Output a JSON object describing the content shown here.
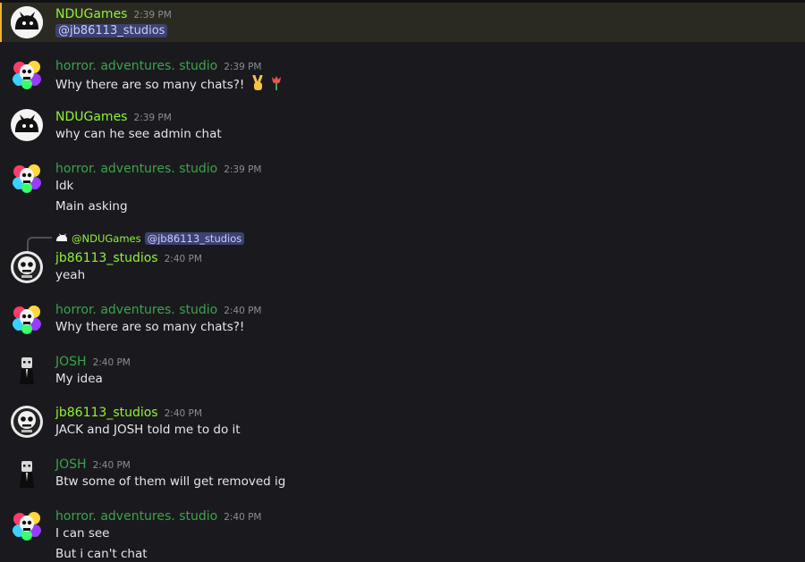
{
  "users": {
    "ndu": "NDUGames",
    "horror": "horror. adventures. studio",
    "jb": "jb86113_studios",
    "josh": "JOSH"
  },
  "colors": {
    "background": "#1a1a1e",
    "highlight": "#2b2a22",
    "green_name": "#8ff238",
    "dark_green_name": "#3ca34a",
    "mention_bg": "#3c4270"
  },
  "messages": [
    {
      "author": "NDUGames",
      "time": "2:39 PM",
      "lines": [
        "@jb86113_studios"
      ]
    },
    {
      "author": "horror. adventures. studio",
      "time": "2:39 PM",
      "lines": [
        "Why there are so many chats?!"
      ],
      "emojis": [
        "victory-hand-icon",
        "tulip-icon"
      ]
    },
    {
      "author": "NDUGames",
      "time": "2:39 PM",
      "lines": [
        "why can he see admin chat"
      ]
    },
    {
      "author": "horror. adventures. studio",
      "time": "2:39 PM",
      "lines": [
        "Idk",
        "Main asking"
      ]
    },
    {
      "author": "jb86113_studios",
      "time": "2:40 PM",
      "lines": [
        "yeah"
      ],
      "reply": {
        "author": "@NDUGames",
        "mention": "@jb86113_studios"
      }
    },
    {
      "author": "horror. adventures. studio",
      "time": "2:40 PM",
      "lines": [
        "Why there are so many chats?!"
      ]
    },
    {
      "author": "JOSH",
      "time": "2:40 PM",
      "lines": [
        "My idea"
      ]
    },
    {
      "author": "jb86113_studios",
      "time": "2:40 PM",
      "lines": [
        "JACK and JOSH told me to do it"
      ]
    },
    {
      "author": "JOSH",
      "time": "2:40 PM",
      "lines": [
        "Btw some of them will get removed ig"
      ]
    },
    {
      "author": "horror. adventures. studio",
      "time": "2:40 PM",
      "lines": [
        "I can see",
        "But i can't chat"
      ]
    }
  ]
}
